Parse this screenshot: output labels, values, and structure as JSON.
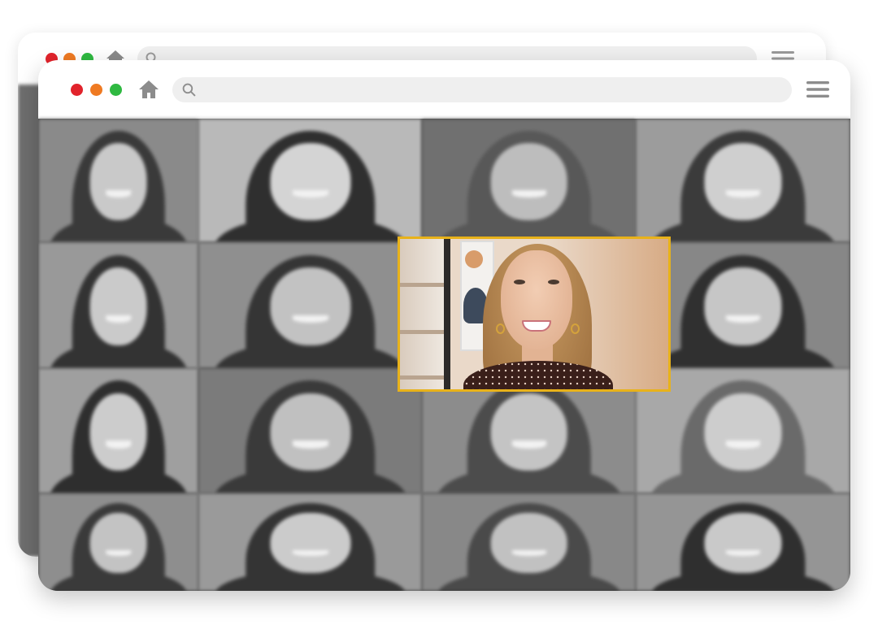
{
  "back_window": {
    "search_placeholder": ""
  },
  "front_window": {
    "search_placeholder": "",
    "icons": {
      "close": "red-dot",
      "minimize": "orange-dot",
      "maximize": "green-dot",
      "home": "home-icon",
      "search": "search-icon",
      "menu": "hamburger-menu-icon"
    }
  },
  "colors": {
    "close": "#e1232b",
    "minimize": "#ef7a22",
    "maximize": "#2fb941",
    "highlight_border": "#e8b21a"
  },
  "gallery": {
    "columns": 4,
    "rows": 4,
    "highlighted_tile": "active-speaker"
  }
}
